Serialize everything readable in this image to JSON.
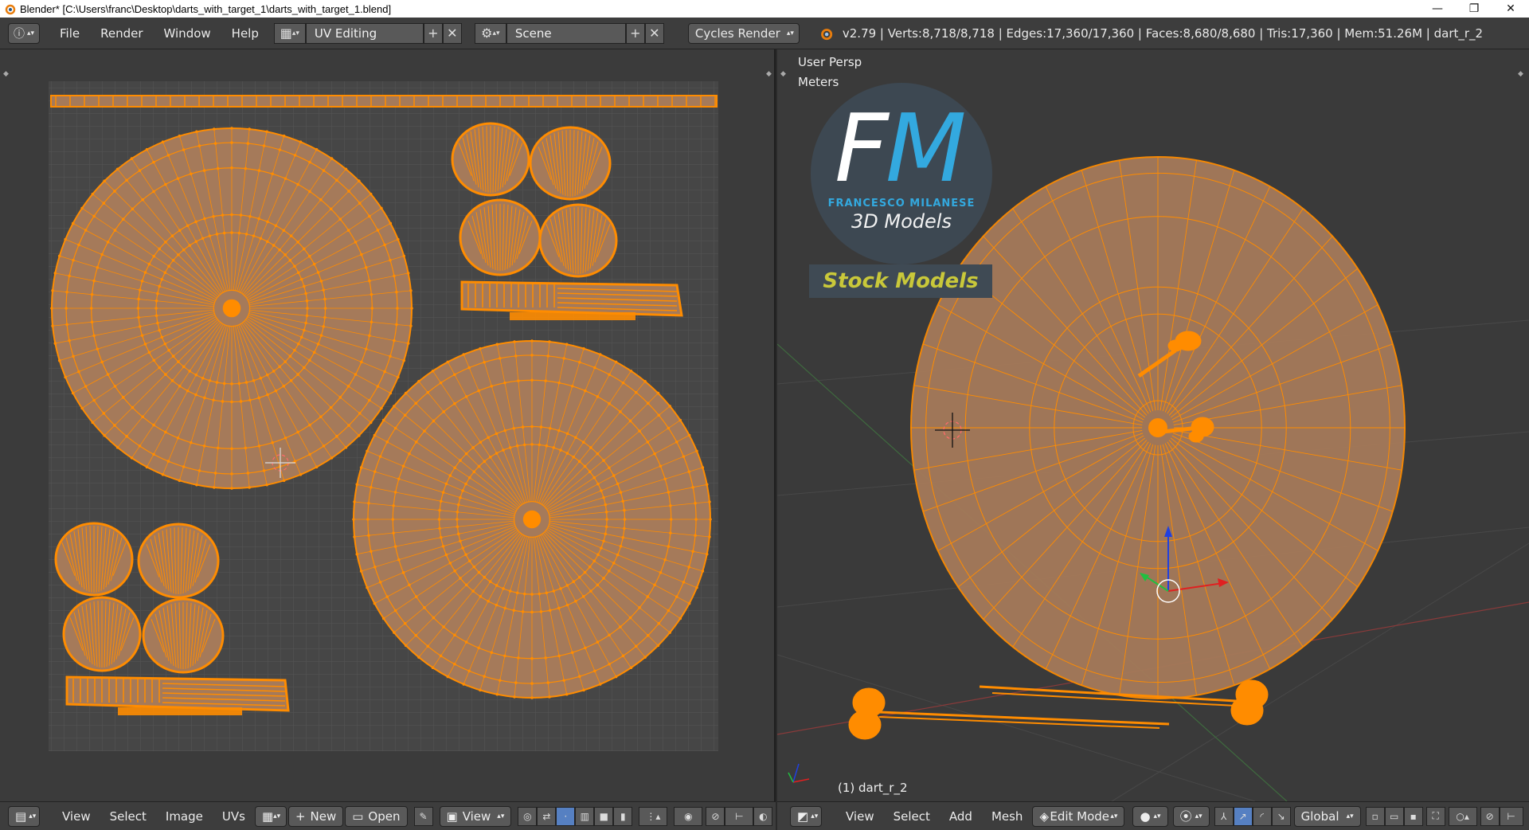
{
  "window": {
    "title": "Blender* [C:\\Users\\franc\\Desktop\\darts_with_target_1\\darts_with_target_1.blend]",
    "minimize": "—",
    "restore": "❐",
    "close": "✕"
  },
  "info_header": {
    "menus": [
      "File",
      "Render",
      "Window",
      "Help"
    ],
    "screen_layout": "UV Editing",
    "scene": "Scene",
    "render_engine": "Cycles Render",
    "stats": "v2.79 | Verts:8,718/8,718 | Edges:17,360/17,360 | Faces:8,680/8,680 | Tris:17,360 | Mem:51.26M | dart_r_2"
  },
  "uv_editor": {
    "menus": [
      "View",
      "Select",
      "Image",
      "UVs"
    ],
    "new_label": "New",
    "open_label": "Open",
    "view_label": "View"
  },
  "view3d": {
    "view_name": "User Persp",
    "units": "Meters",
    "object_label": "(1) dart_r_2",
    "menus": [
      "View",
      "Select",
      "Add",
      "Mesh"
    ],
    "mode": "Edit Mode",
    "orientation": "Global"
  },
  "logo": {
    "f": "F",
    "m": "M",
    "name": "FRANCESCO MILANESE",
    "models": "3D Models",
    "stock": "Stock Models"
  },
  "colors": {
    "mesh_orange": "#ff8c00",
    "face_fill": "#a57a5a",
    "accent_blue": "#5680c2"
  }
}
